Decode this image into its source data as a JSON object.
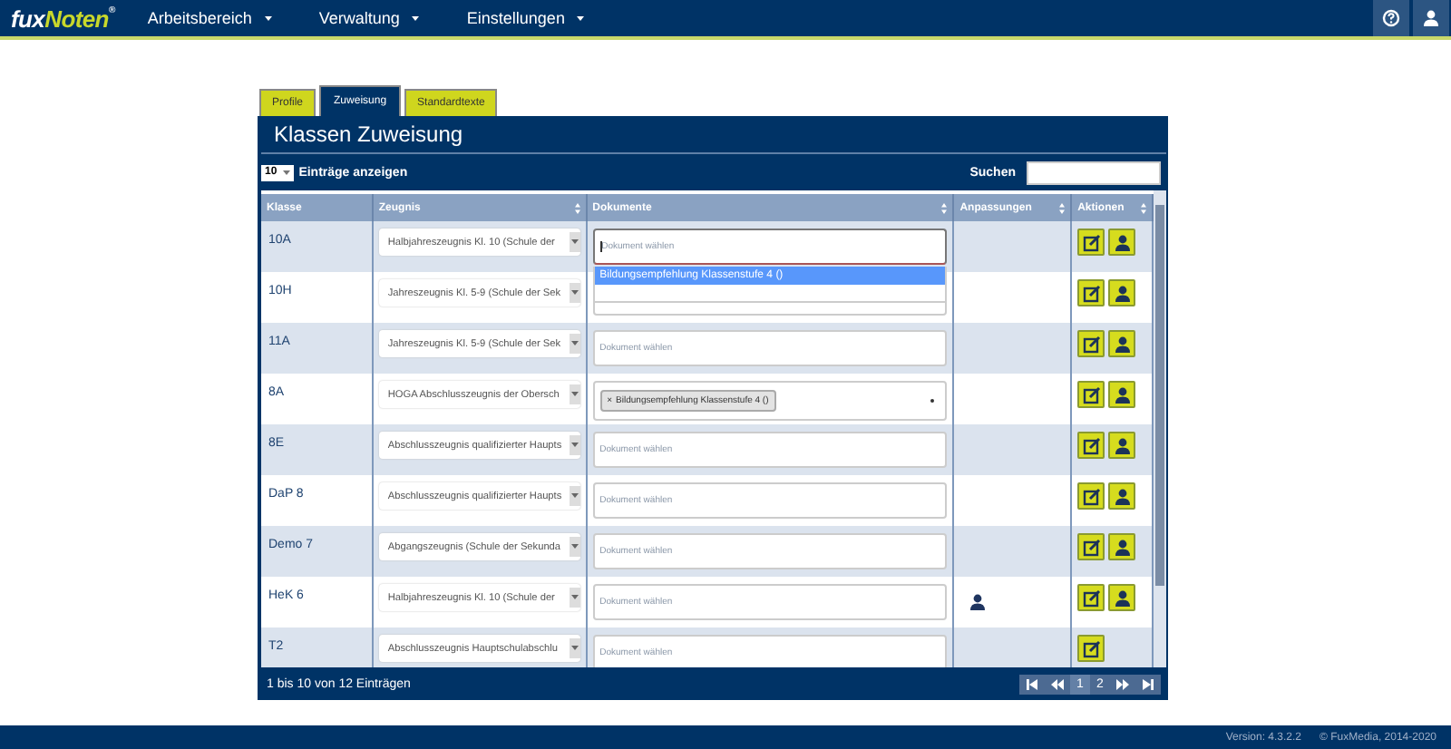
{
  "navbar": {
    "logo": {
      "first": "fux",
      "second": "Noten",
      "mark": "®"
    },
    "menu": [
      {
        "label": "Arbeitsbereich"
      },
      {
        "label": "Verwaltung"
      },
      {
        "label": "Einstellungen"
      }
    ]
  },
  "tabs": [
    {
      "label": "Profile",
      "selected": false
    },
    {
      "label": "Zuweisung",
      "selected": true
    },
    {
      "label": "Standardtexte",
      "selected": false
    }
  ],
  "panel": {
    "title": "Klassen Zuweisung",
    "page_length": "10",
    "page_length_label": "Einträge anzeigen",
    "search_label": "Suchen"
  },
  "table": {
    "columns": [
      {
        "label": "Klasse",
        "sortable": false
      },
      {
        "label": "Zeugnis",
        "sortable": true
      },
      {
        "label": "Dokumente",
        "sortable": true
      },
      {
        "label": "Anpassungen",
        "sortable": true
      },
      {
        "label": "Aktionen",
        "sortable": true
      }
    ],
    "rows": [
      {
        "klasse": "10A",
        "zeugnis": "Halbjahreszeugnis Kl. 10 (Schule der",
        "documents": {
          "kind": "empty",
          "placeholder": "Dokument wählen",
          "focused": true,
          "options": [
            {
              "label": "Bildungsempfehlung Klassenstufe 4 ()",
              "selected": true
            }
          ]
        },
        "adjusted": false,
        "actions": [
          {
            "kind": "edit"
          },
          {
            "kind": "person"
          }
        ]
      },
      {
        "klasse": "10H",
        "zeugnis": "Jahreszeugnis Kl. 5-9 (Schule der Sek",
        "documents": {
          "kind": "empty",
          "focused": false
        },
        "adjusted": false,
        "actions": [
          {
            "kind": "edit"
          },
          {
            "kind": "person"
          }
        ]
      },
      {
        "klasse": "11A",
        "zeugnis": "Jahreszeugnis Kl. 5-9 (Schule der Sek",
        "documents": {
          "kind": "empty",
          "placeholder": "Dokument wählen",
          "focused": false
        },
        "adjusted": false,
        "actions": [
          {
            "kind": "edit"
          },
          {
            "kind": "person"
          }
        ]
      },
      {
        "klasse": "8A",
        "zeugnis": "HOGA Abschlusszeugnis der Obersch",
        "documents": {
          "kind": "tags",
          "tags": [
            {
              "remove": "×",
              "label": "Bildungsempfehlung Klassenstufe 4 ()"
            }
          ]
        },
        "adjusted": false,
        "actions": [
          {
            "kind": "edit"
          },
          {
            "kind": "person"
          }
        ]
      },
      {
        "klasse": "8E",
        "zeugnis": "Abschlusszeugnis qualifizierter Haupts",
        "documents": {
          "kind": "empty",
          "placeholder": "Dokument wählen",
          "focused": false
        },
        "adjusted": false,
        "actions": [
          {
            "kind": "edit"
          },
          {
            "kind": "person"
          }
        ]
      },
      {
        "klasse": "DaP 8",
        "zeugnis": "Abschlusszeugnis qualifizierter Haupts",
        "documents": {
          "kind": "empty",
          "placeholder": "Dokument wählen",
          "focused": false
        },
        "adjusted": false,
        "actions": [
          {
            "kind": "edit"
          },
          {
            "kind": "person"
          }
        ]
      },
      {
        "klasse": "Demo 7",
        "zeugnis": "Abgangszeugnis (Schule der Sekunda",
        "documents": {
          "kind": "empty",
          "placeholder": "Dokument wählen",
          "focused": false
        },
        "adjusted": false,
        "actions": [
          {
            "kind": "edit"
          },
          {
            "kind": "person"
          }
        ]
      },
      {
        "klasse": "HeK 6",
        "zeugnis": "Halbjahreszeugnis Kl. 10 (Schule der",
        "documents": {
          "kind": "empty",
          "placeholder": "Dokument wählen",
          "focused": false
        },
        "adjusted": true,
        "actions": [
          {
            "kind": "edit"
          },
          {
            "kind": "person"
          }
        ]
      },
      {
        "klasse": "T2",
        "zeugnis": "Abschlusszeugnis Hauptschulabschlu",
        "documents": {
          "kind": "empty",
          "placeholder": "Dokument wählen",
          "focused": false
        },
        "adjusted": false,
        "actions": [
          {
            "kind": "edit"
          }
        ]
      }
    ]
  },
  "table_footer": {
    "info": "1 bis 10 von 12 Einträgen",
    "pages": [
      {
        "label": "1",
        "selected": true
      },
      {
        "label": "2",
        "selected": false
      }
    ]
  },
  "page_footer": {
    "version": "Version: 4.3.2.2",
    "copyright": "© FuxMedia, 2014-2020"
  }
}
